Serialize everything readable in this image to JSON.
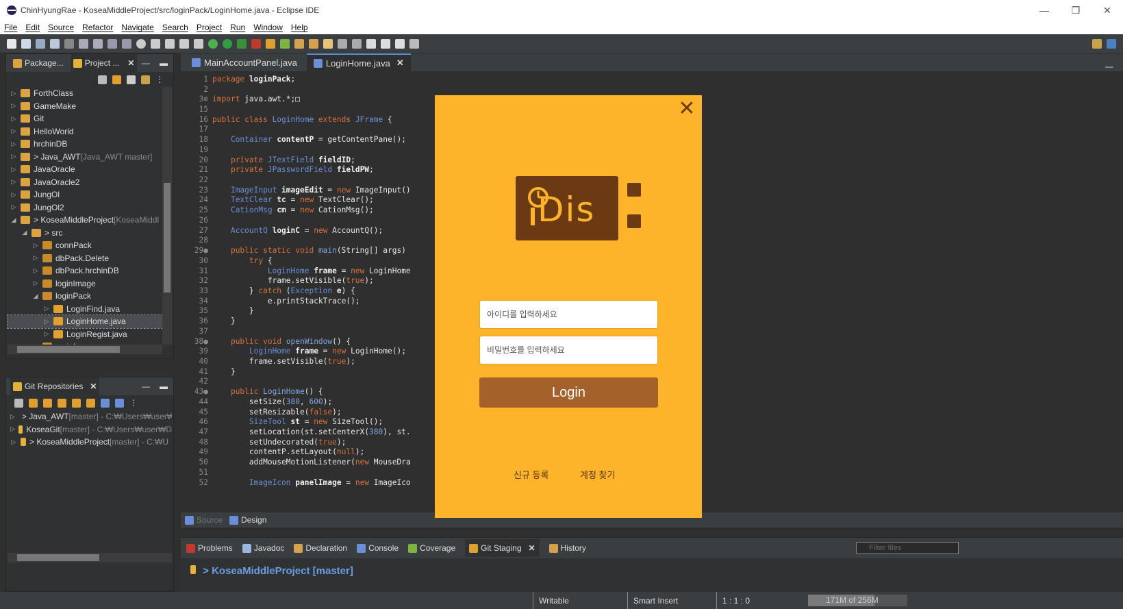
{
  "window": {
    "title": "ChinHyungRae - KoseaMiddleProject/src/loginPack/LoginHome.java - Eclipse IDE",
    "minimize": "—",
    "restore": "❐",
    "close": "✕"
  },
  "menu": [
    "File",
    "Edit",
    "Source",
    "Refactor",
    "Navigate",
    "Search",
    "Project",
    "Run",
    "Window",
    "Help"
  ],
  "explorer": {
    "tab_package": "Package...",
    "tab_project": "Project ...",
    "items": [
      {
        "label": "ForthClass",
        "suffix": "",
        "indent": 0,
        "twisty": "▷"
      },
      {
        "label": "GameMake",
        "suffix": "",
        "indent": 0,
        "twisty": "▷"
      },
      {
        "label": "Git",
        "suffix": "",
        "indent": 0,
        "twisty": "▷"
      },
      {
        "label": "HelloWorld",
        "suffix": "",
        "indent": 0,
        "twisty": "▷"
      },
      {
        "label": "hrchinDB",
        "suffix": "",
        "indent": 0,
        "twisty": "▷"
      },
      {
        "label": "> Java_AWT",
        "suffix": " [Java_AWT master]",
        "indent": 0,
        "twisty": "▷"
      },
      {
        "label": "JavaOracle",
        "suffix": "",
        "indent": 0,
        "twisty": "▷"
      },
      {
        "label": "JavaOracle2",
        "suffix": "",
        "indent": 0,
        "twisty": "▷"
      },
      {
        "label": "JungOl",
        "suffix": "",
        "indent": 0,
        "twisty": "▷"
      },
      {
        "label": "JungOl2",
        "suffix": "",
        "indent": 0,
        "twisty": "▷"
      },
      {
        "label": "> KoseaMiddleProject",
        "suffix": " [KoseaMiddl",
        "indent": 0,
        "twisty": "◢"
      },
      {
        "label": "> src",
        "suffix": "",
        "indent": 1,
        "twisty": "◢"
      },
      {
        "label": "connPack",
        "suffix": "",
        "indent": 2,
        "twisty": "▷"
      },
      {
        "label": "dbPack.Delete",
        "suffix": "",
        "indent": 2,
        "twisty": "▷"
      },
      {
        "label": "dbPack.hrchinDB",
        "suffix": "",
        "indent": 2,
        "twisty": "▷"
      },
      {
        "label": "loginImage",
        "suffix": "",
        "indent": 2,
        "twisty": "▷"
      },
      {
        "label": "loginPack",
        "suffix": "",
        "indent": 2,
        "twisty": "◢"
      },
      {
        "label": "LoginFind.java",
        "suffix": "",
        "indent": 3,
        "twisty": "▷"
      },
      {
        "label": "LoginHome.java",
        "suffix": "",
        "indent": 3,
        "twisty": "▷"
      },
      {
        "label": "LoginRegist.java",
        "suffix": "",
        "indent": 3,
        "twisty": "▷"
      },
      {
        "label": "mainIcon",
        "suffix": "",
        "indent": 2,
        "twisty": "▷"
      }
    ]
  },
  "git_repos": {
    "tab": "Git Repositories",
    "items": [
      {
        "label": "> Java_AWT",
        "suffix": " [master] - C:₩Users₩user₩"
      },
      {
        "label": "KoseaGit",
        "suffix": " [master] - C:₩Users₩user₩D"
      },
      {
        "label": "> KoseaMiddleProject",
        "suffix": " [master] - C:₩U"
      }
    ]
  },
  "editor": {
    "tabs": [
      "MainAccountPanel.java",
      "LoginHome.java"
    ],
    "bottom_tabs": [
      "Source",
      "Design"
    ],
    "lines": [
      {
        "n": "1",
        "t": [
          [
            "kw",
            "package "
          ],
          [
            "fd",
            "loginPack"
          ],
          [
            "tx",
            ";"
          ]
        ]
      },
      {
        "n": "2",
        "t": []
      },
      {
        "n": "3⊕",
        "t": [
          [
            "kw",
            "import "
          ],
          [
            "tx",
            "java.awt.*;"
          ],
          [
            "tx",
            "□"
          ]
        ]
      },
      {
        "n": "15",
        "t": []
      },
      {
        "n": "16",
        "t": [
          [
            "kw",
            "public class "
          ],
          [
            "ty",
            "LoginHome"
          ],
          [
            "kw",
            " extends "
          ],
          [
            "ty",
            "JFrame"
          ],
          [
            "tx",
            " {"
          ]
        ]
      },
      {
        "n": "17",
        "t": []
      },
      {
        "n": "18",
        "t": [
          [
            "tx",
            "    "
          ],
          [
            "ty",
            "Container "
          ],
          [
            "fd",
            "contentP"
          ],
          [
            "tx",
            " = getContentPane();"
          ]
        ]
      },
      {
        "n": "19",
        "t": []
      },
      {
        "n": "20",
        "t": [
          [
            "tx",
            "    "
          ],
          [
            "kw",
            "private "
          ],
          [
            "ty",
            "JTextField "
          ],
          [
            "fd",
            "fieldID"
          ],
          [
            "tx",
            ";"
          ]
        ]
      },
      {
        "n": "21",
        "t": [
          [
            "tx",
            "    "
          ],
          [
            "kw",
            "private "
          ],
          [
            "ty",
            "JPasswordField "
          ],
          [
            "fd",
            "fieldPW"
          ],
          [
            "tx",
            ";"
          ]
        ]
      },
      {
        "n": "22",
        "t": []
      },
      {
        "n": "23",
        "t": [
          [
            "tx",
            "    "
          ],
          [
            "ty",
            "ImageInput "
          ],
          [
            "fd",
            "imageEdit"
          ],
          [
            "tx",
            " = "
          ],
          [
            "kw",
            "new "
          ],
          [
            "tx",
            "ImageInput()"
          ]
        ]
      },
      {
        "n": "24",
        "t": [
          [
            "tx",
            "    "
          ],
          [
            "ty",
            "TextClear "
          ],
          [
            "fd",
            "tc"
          ],
          [
            "tx",
            " = "
          ],
          [
            "kw",
            "new "
          ],
          [
            "tx",
            "TextClear();"
          ]
        ]
      },
      {
        "n": "25",
        "t": [
          [
            "tx",
            "    "
          ],
          [
            "ty",
            "CationMsg "
          ],
          [
            "fd",
            "cm"
          ],
          [
            "tx",
            " = "
          ],
          [
            "kw",
            "new "
          ],
          [
            "tx",
            "CationMsg();"
          ]
        ]
      },
      {
        "n": "26",
        "t": []
      },
      {
        "n": "27",
        "t": [
          [
            "tx",
            "    "
          ],
          [
            "ty",
            "AccountQ "
          ],
          [
            "fd",
            "loginC"
          ],
          [
            "tx",
            " = "
          ],
          [
            "kw",
            "new "
          ],
          [
            "tx",
            "AccountQ();"
          ]
        ]
      },
      {
        "n": "28",
        "t": []
      },
      {
        "n": "29●",
        "t": [
          [
            "tx",
            "    "
          ],
          [
            "kw",
            "public static void "
          ],
          [
            "nm",
            "main"
          ],
          [
            "tx",
            "(String[] args)"
          ]
        ]
      },
      {
        "n": "30",
        "t": [
          [
            "tx",
            "        "
          ],
          [
            "kw",
            "try "
          ],
          [
            "tx",
            "{"
          ]
        ]
      },
      {
        "n": "31",
        "t": [
          [
            "tx",
            "            "
          ],
          [
            "ty",
            "LoginHome "
          ],
          [
            "fd",
            "frame"
          ],
          [
            "tx",
            " = "
          ],
          [
            "kw",
            "new "
          ],
          [
            "tx",
            "LoginHome"
          ]
        ]
      },
      {
        "n": "32",
        "t": [
          [
            "tx",
            "            frame.setVisible("
          ],
          [
            "kw",
            "true"
          ],
          [
            "tx",
            ");"
          ]
        ]
      },
      {
        "n": "33",
        "t": [
          [
            "tx",
            "        } "
          ],
          [
            "kw",
            "catch "
          ],
          [
            "tx",
            "("
          ],
          [
            "ty",
            "Exception "
          ],
          [
            "fd",
            "e"
          ],
          [
            "tx",
            ") {"
          ]
        ]
      },
      {
        "n": "34",
        "t": [
          [
            "tx",
            "            e.printStackTrace();"
          ]
        ]
      },
      {
        "n": "35",
        "t": [
          [
            "tx",
            "        }"
          ]
        ]
      },
      {
        "n": "36",
        "t": [
          [
            "tx",
            "    }"
          ]
        ]
      },
      {
        "n": "37",
        "t": []
      },
      {
        "n": "38●",
        "t": [
          [
            "tx",
            "    "
          ],
          [
            "kw",
            "public void "
          ],
          [
            "nm",
            "openWindow"
          ],
          [
            "tx",
            "() {"
          ]
        ]
      },
      {
        "n": "39",
        "t": [
          [
            "tx",
            "        "
          ],
          [
            "ty",
            "LoginHome "
          ],
          [
            "fd",
            "frame"
          ],
          [
            "tx",
            " = "
          ],
          [
            "kw",
            "new "
          ],
          [
            "tx",
            "LoginHome();"
          ]
        ]
      },
      {
        "n": "40",
        "t": [
          [
            "tx",
            "        frame.setVisible("
          ],
          [
            "kw",
            "true"
          ],
          [
            "tx",
            ");"
          ]
        ]
      },
      {
        "n": "41",
        "t": [
          [
            "tx",
            "    }"
          ]
        ]
      },
      {
        "n": "42",
        "t": []
      },
      {
        "n": "43●",
        "t": [
          [
            "tx",
            "    "
          ],
          [
            "kw",
            "public "
          ],
          [
            "nm",
            "LoginHome"
          ],
          [
            "tx",
            "() {"
          ]
        ]
      },
      {
        "n": "44",
        "t": [
          [
            "tx",
            "        setSize("
          ],
          [
            "nm",
            "380"
          ],
          [
            "tx",
            ", "
          ],
          [
            "nm",
            "600"
          ],
          [
            "tx",
            ");"
          ]
        ]
      },
      {
        "n": "45",
        "t": [
          [
            "tx",
            "        setResizable("
          ],
          [
            "kw",
            "false"
          ],
          [
            "tx",
            ");"
          ]
        ]
      },
      {
        "n": "46",
        "t": [
          [
            "tx",
            "        "
          ],
          [
            "ty",
            "SizeTool "
          ],
          [
            "fd",
            "st"
          ],
          [
            "tx",
            " = "
          ],
          [
            "kw",
            "new "
          ],
          [
            "tx",
            "SizeTool();"
          ]
        ]
      },
      {
        "n": "47",
        "t": [
          [
            "tx",
            "        setLocation(st.setCenterX("
          ],
          [
            "nm",
            "380"
          ],
          [
            "tx",
            "), st."
          ]
        ]
      },
      {
        "n": "48",
        "t": [
          [
            "tx",
            "        setUndecorated("
          ],
          [
            "kw",
            "true"
          ],
          [
            "tx",
            ");"
          ]
        ]
      },
      {
        "n": "49",
        "t": [
          [
            "tx",
            "        contentP.setLayout("
          ],
          [
            "kw",
            "null"
          ],
          [
            "tx",
            ");"
          ]
        ]
      },
      {
        "n": "50",
        "t": [
          [
            "tx",
            "        addMouseMotionListener("
          ],
          [
            "kw",
            "new "
          ],
          [
            "tx",
            "MouseDra"
          ]
        ]
      },
      {
        "n": "51",
        "t": []
      },
      {
        "n": "52",
        "t": [
          [
            "tx",
            "        "
          ],
          [
            "ty",
            "ImageIcon "
          ],
          [
            "fd",
            "panelImage"
          ],
          [
            "tx",
            " = "
          ],
          [
            "kw",
            "new "
          ],
          [
            "tx",
            "ImageIco"
          ]
        ]
      }
    ]
  },
  "bottom_panel": {
    "tabs": [
      {
        "label": "Problems",
        "icon": "problems-icon",
        "active": false
      },
      {
        "label": "Javadoc",
        "icon": "javadoc-icon",
        "active": false
      },
      {
        "label": "Declaration",
        "icon": "declaration-icon",
        "active": false
      },
      {
        "label": "Console",
        "icon": "console-icon",
        "active": false
      },
      {
        "label": "Coverage",
        "icon": "coverage-icon",
        "active": false
      },
      {
        "label": "Git Staging",
        "icon": "git-staging-icon",
        "active": true
      },
      {
        "label": "History",
        "icon": "history-icon",
        "active": false
      }
    ],
    "filter_placeholder": "Filter files",
    "repo_label": "> KoseaMiddleProject [master]"
  },
  "status": {
    "writable": "Writable",
    "insert_mode": "Smart Insert",
    "position": "1 : 1 : 0",
    "memory": "171M of 256M",
    "memory_used_fraction": 0.67
  },
  "login_window": {
    "logo_text": "Dis",
    "id_placeholder": "아이디를 입력하세요",
    "pw_placeholder": "비밀번호를 입력하세요",
    "login_label": "Login",
    "register_label": "신규 등록",
    "find_label": "계정 찾기",
    "close_glyph": "✕",
    "colors": {
      "background": "#fdb42b",
      "brown": "#6b3a12",
      "button": "#a4612a"
    }
  }
}
